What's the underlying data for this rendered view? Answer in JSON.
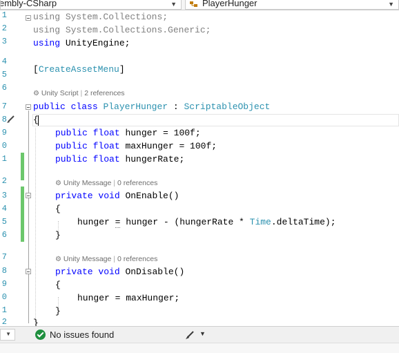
{
  "top_bar": {
    "project_dropdown": "embly-CSharp",
    "member_dropdown": "PlayerHunger"
  },
  "line_numbers": [
    "1",
    "2",
    "3",
    "4",
    "5",
    "6",
    "7",
    "8",
    "9",
    "0",
    "1",
    "2",
    "3",
    "4",
    "5",
    "6",
    "7",
    "8",
    "9",
    "0",
    "1",
    "2"
  ],
  "code_lens": {
    "class_lens": {
      "label": "Unity Script",
      "refs": "2 references"
    },
    "onenable_lens": {
      "label": "Unity Message",
      "refs": "0 references"
    },
    "ondisable_lens": {
      "label": "Unity Message",
      "refs": "0 references"
    }
  },
  "code": {
    "l1_kw": "using",
    "l1_ns": " System.Collections;",
    "l2_kw": "using",
    "l2_ns": " System.Collections.Generic;",
    "l3_kw": "using",
    "l3_ns": " UnityEngine;",
    "l5_open": "[",
    "l5_attr": "CreateAssetMenu",
    "l5_close": "]",
    "l7_kw1": "public",
    "l7_kw2": "class",
    "l7_name": "PlayerHunger",
    "l7_colon": " : ",
    "l7_base": "ScriptableObject",
    "l8_brace": "{",
    "l9_kw1": "public",
    "l9_kw2": "float",
    "l9_rest": " hunger = 100f;",
    "l10_kw1": "public",
    "l10_kw2": "float",
    "l10_rest": " maxHunger = 100f;",
    "l11_kw1": "public",
    "l11_kw2": "float",
    "l11_rest": " hungerRate;",
    "l13_kw1": "private",
    "l13_kw2": "void",
    "l13_rest": " OnEnable()",
    "l14_brace": "{",
    "l15_a": "hunger ",
    "l15_eq": "=",
    "l15_b": " hunger - (hungerRate * ",
    "l15_type": "Time",
    "l15_c": ".deltaTime);",
    "l16_brace": "}",
    "l18_kw1": "private",
    "l18_kw2": "void",
    "l18_rest": " OnDisable()",
    "l19_brace": "{",
    "l20_text": "hunger = maxHunger;",
    "l21_brace": "}",
    "l22_brace": "}"
  },
  "status_bar": {
    "issues_text": "No issues found"
  },
  "colors": {
    "keyword": "#0000ff",
    "type": "#2b91af",
    "comment_gray": "#808080",
    "change_bar": "#6cc76c",
    "ok_green": "#1e8f3e"
  }
}
